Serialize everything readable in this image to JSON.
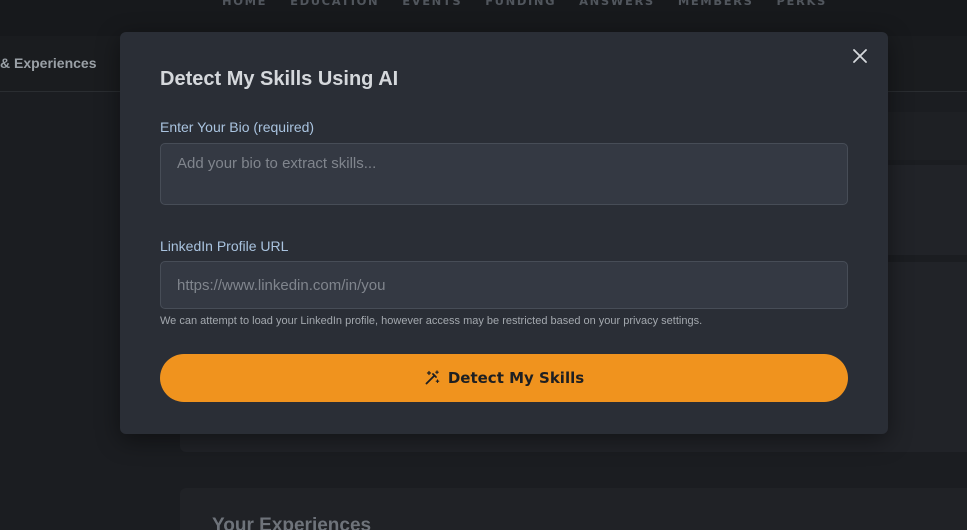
{
  "nav": {
    "items": [
      "HOME",
      "EDUCATION",
      "EVENTS",
      "FUNDING",
      "ANSWERS",
      "MEMBERS",
      "PERKS"
    ]
  },
  "subnav": {
    "tab_label": "& Experiences"
  },
  "background": {
    "section_title": "Your Experiences"
  },
  "modal": {
    "title": "Detect My Skills Using AI",
    "close_icon": "close-icon",
    "bio": {
      "label": "Enter Your Bio (required)",
      "value": "",
      "placeholder": "Add your bio to extract skills..."
    },
    "linkedin": {
      "label": "LinkedIn Profile URL",
      "value": "",
      "placeholder": "https://www.linkedin.com/in/you",
      "help": "We can attempt to load your LinkedIn profile, however access may be restricted based on your privacy settings."
    },
    "detect_button": {
      "label": "Detect My Skills",
      "icon": "magic-wand-icon"
    }
  },
  "colors": {
    "accent": "#f0931e",
    "modal_bg": "#2a2e36",
    "page_bg": "#1b1d21",
    "label": "#a9c3df"
  }
}
